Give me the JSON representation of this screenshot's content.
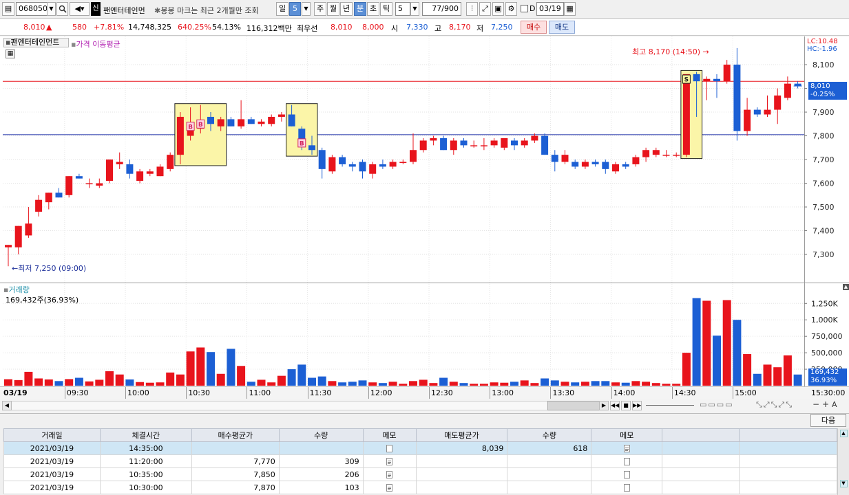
{
  "toolbar": {
    "stock_code": "068050",
    "credit_badge": "신",
    "stock_name": "팬엔터테인먼",
    "note": "봉봉 마크는 최근 2개월만 조회",
    "periods": [
      "일",
      "주",
      "월",
      "년",
      "분",
      "초",
      "틱"
    ],
    "period_value": "5",
    "active_period": "분",
    "minute_value": "5",
    "count": "77",
    "count_total": "/900",
    "date": "03/19",
    "d_label": "D"
  },
  "quote": {
    "price": "8,010",
    "change_arrow": "▲",
    "change": "580",
    "change_rate": "+7.81%",
    "volume": "14,748,325",
    "volume_rate": "640.25%",
    "turnover": "54.13%",
    "amount": "116,312백만",
    "best_label": "최우선",
    "best_ask": "8,010",
    "best_bid": "8,000",
    "open_label": "시",
    "open": "7,330",
    "high_label": "고",
    "high": "8,170",
    "low_label": "저",
    "low": "7,250",
    "buy_button": "매수",
    "sell_button": "매도"
  },
  "chart": {
    "stock_tag": "팬엔터테인먼트",
    "ma_label": "가격 이동평균",
    "lc_label": "LC:10.48",
    "hc_label": "HC:-1.96",
    "high_annotation": "최고 8,170 (14:50)",
    "low_annotation": "최저 7,250 (09:00)",
    "price_tag": "8,010",
    "price_tag_rate": "-0.25%",
    "volume_title": "거래량",
    "volume_info": "169,432주(36.93%)",
    "volume_tag": "169,432",
    "volume_tag_rate": "36.93%",
    "date_label": "03/19",
    "end_time": "15:30:00",
    "next_button": "다음"
  },
  "chart_data": {
    "type": "candlestick",
    "price_ticks": [
      "8,100",
      "8,000",
      "7,900",
      "7,800",
      "7,700",
      "7,600",
      "7,500",
      "7,400",
      "7,300"
    ],
    "volume_ticks": [
      "1,250K",
      "1,000K",
      "750,000",
      "500,000",
      "250,000"
    ],
    "time_ticks": [
      "09:30",
      "10:00",
      "10:30",
      "11:00",
      "11:30",
      "12:00",
      "12:30",
      "13:00",
      "13:30",
      "14:00",
      "14:30",
      "15:00"
    ],
    "up_color": "#e8141c",
    "down_color": "#1c5fd4",
    "hline_red": 8030,
    "hline_blue": 7805,
    "candles": [
      {
        "o": 7330,
        "h": 7340,
        "l": 7250,
        "c": 7340,
        "v": 98000
      },
      {
        "o": 7330,
        "h": 7420,
        "l": 7300,
        "c": 7420,
        "v": 85000
      },
      {
        "o": 7380,
        "h": 7500,
        "l": 7370,
        "c": 7430,
        "v": 210000
      },
      {
        "o": 7480,
        "h": 7550,
        "l": 7460,
        "c": 7530,
        "v": 110000
      },
      {
        "o": 7520,
        "h": 7560,
        "l": 7490,
        "c": 7560,
        "v": 95000
      },
      {
        "o": 7560,
        "h": 7580,
        "l": 7540,
        "c": 7540,
        "v": 70000
      },
      {
        "o": 7550,
        "h": 7630,
        "l": 7540,
        "c": 7630,
        "v": 100000
      },
      {
        "o": 7630,
        "h": 7640,
        "l": 7620,
        "c": 7620,
        "v": 120000
      },
      {
        "o": 7600,
        "h": 7620,
        "l": 7580,
        "c": 7600,
        "v": 65000
      },
      {
        "o": 7590,
        "h": 7620,
        "l": 7580,
        "c": 7600,
        "v": 90000
      },
      {
        "o": 7610,
        "h": 7700,
        "l": 7600,
        "c": 7700,
        "v": 220000
      },
      {
        "o": 7680,
        "h": 7730,
        "l": 7660,
        "c": 7690,
        "v": 170000
      },
      {
        "o": 7680,
        "h": 7700,
        "l": 7620,
        "c": 7640,
        "v": 95000
      },
      {
        "o": 7610,
        "h": 7660,
        "l": 7600,
        "c": 7650,
        "v": 55000
      },
      {
        "o": 7640,
        "h": 7660,
        "l": 7630,
        "c": 7650,
        "v": 45000
      },
      {
        "o": 7630,
        "h": 7680,
        "l": 7630,
        "c": 7670,
        "v": 50000
      },
      {
        "o": 7660,
        "h": 7730,
        "l": 7650,
        "c": 7720,
        "v": 200000
      },
      {
        "o": 7720,
        "h": 7900,
        "l": 7680,
        "c": 7880,
        "v": 170000
      },
      {
        "o": 7800,
        "h": 7920,
        "l": 7780,
        "c": 7850,
        "v": 520000
      },
      {
        "o": 7830,
        "h": 7930,
        "l": 7810,
        "c": 7860,
        "v": 580000
      },
      {
        "o": 7880,
        "h": 7900,
        "l": 7820,
        "c": 7850,
        "v": 510000
      },
      {
        "o": 7840,
        "h": 7880,
        "l": 7820,
        "c": 7870,
        "v": 180000
      },
      {
        "o": 7870,
        "h": 7880,
        "l": 7840,
        "c": 7840,
        "v": 560000
      },
      {
        "o": 7840,
        "h": 7950,
        "l": 7830,
        "c": 7870,
        "v": 300000
      },
      {
        "o": 7870,
        "h": 7880,
        "l": 7850,
        "c": 7850,
        "v": 60000
      },
      {
        "o": 7850,
        "h": 7870,
        "l": 7840,
        "c": 7860,
        "v": 90000
      },
      {
        "o": 7850,
        "h": 7890,
        "l": 7840,
        "c": 7880,
        "v": 50000
      },
      {
        "o": 7880,
        "h": 7900,
        "l": 7860,
        "c": 7890,
        "v": 150000
      },
      {
        "o": 7890,
        "h": 7930,
        "l": 7840,
        "c": 7840,
        "v": 250000
      },
      {
        "o": 7830,
        "h": 7840,
        "l": 7740,
        "c": 7760,
        "v": 320000
      },
      {
        "o": 7760,
        "h": 7800,
        "l": 7720,
        "c": 7740,
        "v": 120000
      },
      {
        "o": 7740,
        "h": 7750,
        "l": 7620,
        "c": 7660,
        "v": 140000
      },
      {
        "o": 7650,
        "h": 7720,
        "l": 7640,
        "c": 7710,
        "v": 70000
      },
      {
        "o": 7710,
        "h": 7720,
        "l": 7670,
        "c": 7680,
        "v": 50000
      },
      {
        "o": 7680,
        "h": 7690,
        "l": 7650,
        "c": 7670,
        "v": 60000
      },
      {
        "o": 7690,
        "h": 7700,
        "l": 7620,
        "c": 7650,
        "v": 80000
      },
      {
        "o": 7640,
        "h": 7690,
        "l": 7620,
        "c": 7680,
        "v": 50000
      },
      {
        "o": 7680,
        "h": 7700,
        "l": 7660,
        "c": 7670,
        "v": 40000
      },
      {
        "o": 7670,
        "h": 7700,
        "l": 7660,
        "c": 7690,
        "v": 60000
      },
      {
        "o": 7690,
        "h": 7700,
        "l": 7680,
        "c": 7690,
        "v": 30000
      },
      {
        "o": 7690,
        "h": 7810,
        "l": 7680,
        "c": 7740,
        "v": 70000
      },
      {
        "o": 7740,
        "h": 7790,
        "l": 7730,
        "c": 7780,
        "v": 90000
      },
      {
        "o": 7780,
        "h": 7800,
        "l": 7760,
        "c": 7790,
        "v": 40000
      },
      {
        "o": 7790,
        "h": 7800,
        "l": 7740,
        "c": 7740,
        "v": 120000
      },
      {
        "o": 7740,
        "h": 7790,
        "l": 7720,
        "c": 7780,
        "v": 60000
      },
      {
        "o": 7780,
        "h": 7790,
        "l": 7750,
        "c": 7760,
        "v": 40000
      },
      {
        "o": 7760,
        "h": 7780,
        "l": 7750,
        "c": 7760,
        "v": 30000
      },
      {
        "o": 7760,
        "h": 7790,
        "l": 7740,
        "c": 7760,
        "v": 30000
      },
      {
        "o": 7760,
        "h": 7790,
        "l": 7750,
        "c": 7780,
        "v": 50000
      },
      {
        "o": 7750,
        "h": 7790,
        "l": 7740,
        "c": 7790,
        "v": 45000
      },
      {
        "o": 7780,
        "h": 7790,
        "l": 7740,
        "c": 7760,
        "v": 60000
      },
      {
        "o": 7760,
        "h": 7790,
        "l": 7750,
        "c": 7780,
        "v": 80000
      },
      {
        "o": 7780,
        "h": 7810,
        "l": 7770,
        "c": 7800,
        "v": 40000
      },
      {
        "o": 7800,
        "h": 7810,
        "l": 7720,
        "c": 7720,
        "v": 110000
      },
      {
        "o": 7720,
        "h": 7740,
        "l": 7650,
        "c": 7690,
        "v": 80000
      },
      {
        "o": 7690,
        "h": 7740,
        "l": 7680,
        "c": 7720,
        "v": 60000
      },
      {
        "o": 7690,
        "h": 7700,
        "l": 7660,
        "c": 7670,
        "v": 50000
      },
      {
        "o": 7670,
        "h": 7700,
        "l": 7660,
        "c": 7690,
        "v": 60000
      },
      {
        "o": 7690,
        "h": 7700,
        "l": 7670,
        "c": 7680,
        "v": 70000
      },
      {
        "o": 7690,
        "h": 7700,
        "l": 7640,
        "c": 7660,
        "v": 70000
      },
      {
        "o": 7650,
        "h": 7690,
        "l": 7640,
        "c": 7680,
        "v": 50000
      },
      {
        "o": 7680,
        "h": 7690,
        "l": 7660,
        "c": 7670,
        "v": 45000
      },
      {
        "o": 7680,
        "h": 7720,
        "l": 7670,
        "c": 7710,
        "v": 70000
      },
      {
        "o": 7710,
        "h": 7750,
        "l": 7690,
        "c": 7740,
        "v": 60000
      },
      {
        "o": 7720,
        "h": 7750,
        "l": 7710,
        "c": 7740,
        "v": 40000
      },
      {
        "o": 7720,
        "h": 7740,
        "l": 7710,
        "c": 7720,
        "v": 30000
      },
      {
        "o": 7720,
        "h": 7730,
        "l": 7710,
        "c": 7720,
        "v": 30000
      },
      {
        "o": 7720,
        "h": 8050,
        "l": 7710,
        "c": 8060,
        "v": 500000
      },
      {
        "o": 8060,
        "h": 8070,
        "l": 7880,
        "c": 8030,
        "v": 1330000
      },
      {
        "o": 8030,
        "h": 8050,
        "l": 7950,
        "c": 8040,
        "v": 1290000
      },
      {
        "o": 8040,
        "h": 8060,
        "l": 7960,
        "c": 8030,
        "v": 760000
      },
      {
        "o": 8030,
        "h": 8120,
        "l": 8020,
        "c": 8100,
        "v": 1300000
      },
      {
        "o": 8100,
        "h": 8170,
        "l": 7780,
        "c": 7820,
        "v": 1000000
      },
      {
        "o": 7820,
        "h": 7960,
        "l": 7800,
        "c": 7910,
        "v": 480000
      },
      {
        "o": 7910,
        "h": 7920,
        "l": 7880,
        "c": 7890,
        "v": 180000
      },
      {
        "o": 7890,
        "h": 7970,
        "l": 7880,
        "c": 7910,
        "v": 320000
      },
      {
        "o": 7910,
        "h": 8000,
        "l": 7850,
        "c": 7970,
        "v": 280000
      },
      {
        "o": 7960,
        "h": 8050,
        "l": 7950,
        "c": 8020,
        "v": 460000
      },
      {
        "o": 8020,
        "h": 8030,
        "l": 8000,
        "c": 8010,
        "v": 169432
      }
    ],
    "markers": [
      {
        "index": 18,
        "type": "B",
        "price": 7840
      },
      {
        "index": 19,
        "type": "B",
        "price": 7850
      },
      {
        "index": 29,
        "type": "B",
        "price": 7770
      },
      {
        "index": 67,
        "type": "S",
        "price": 8039
      }
    ]
  },
  "trades": {
    "headers": [
      "거래일",
      "체결시간",
      "매수평균가",
      "수량",
      "메모",
      "매도평균가",
      "수량",
      "메모"
    ],
    "rows": [
      {
        "date": "2021/03/19",
        "time": "14:35:00",
        "buy_avg": "",
        "buy_qty": "",
        "sell_avg": "8,039",
        "sell_qty": "618"
      },
      {
        "date": "2021/03/19",
        "time": "11:20:00",
        "buy_avg": "7,770",
        "buy_qty": "309",
        "sell_avg": "",
        "sell_qty": ""
      },
      {
        "date": "2021/03/19",
        "time": "10:35:00",
        "buy_avg": "7,850",
        "buy_qty": "206",
        "sell_avg": "",
        "sell_qty": ""
      },
      {
        "date": "2021/03/19",
        "time": "10:30:00",
        "buy_avg": "7,870",
        "buy_qty": "103",
        "sell_avg": "",
        "sell_qty": ""
      }
    ]
  }
}
